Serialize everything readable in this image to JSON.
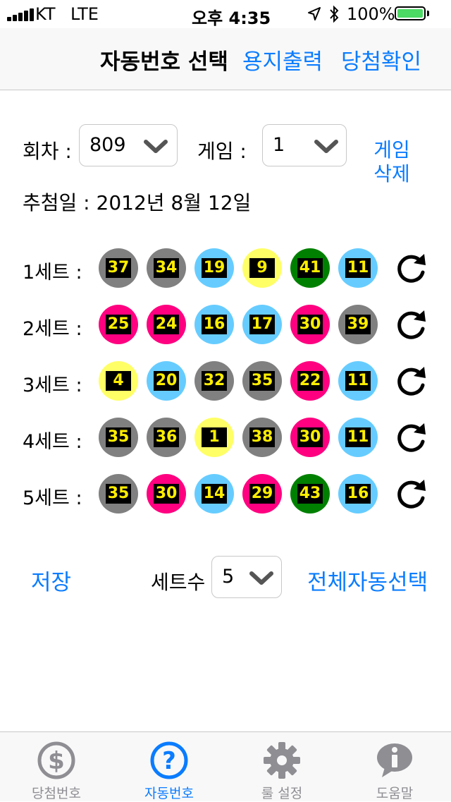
{
  "status": {
    "carrier": "KT",
    "network": "LTE",
    "time": "오후 4:35",
    "battery": "100%"
  },
  "navbar": {
    "title": "자동번호 선택",
    "print_label": "용지출력",
    "check_label": "당첨확인"
  },
  "controls": {
    "round_label": "회차 :",
    "round_value": "809",
    "game_label": "게임 :",
    "game_value": "1",
    "delete_line1": "게임",
    "delete_line2": "삭제",
    "draw_date": "추첨일 : 2012년 8월 12일"
  },
  "sets": [
    {
      "label": "1세트 :",
      "balls": [
        {
          "n": "37",
          "c": "#808080"
        },
        {
          "n": "34",
          "c": "#808080"
        },
        {
          "n": "19",
          "c": "#66ccff"
        },
        {
          "n": "9",
          "c": "#ffff66"
        },
        {
          "n": "41",
          "c": "#008000"
        },
        {
          "n": "11",
          "c": "#66ccff"
        }
      ]
    },
    {
      "label": "2세트 :",
      "balls": [
        {
          "n": "25",
          "c": "#ff0080"
        },
        {
          "n": "24",
          "c": "#ff0080"
        },
        {
          "n": "16",
          "c": "#66ccff"
        },
        {
          "n": "17",
          "c": "#66ccff"
        },
        {
          "n": "30",
          "c": "#ff0080"
        },
        {
          "n": "39",
          "c": "#808080"
        }
      ]
    },
    {
      "label": "3세트 :",
      "balls": [
        {
          "n": "4",
          "c": "#ffff66"
        },
        {
          "n": "20",
          "c": "#66ccff"
        },
        {
          "n": "32",
          "c": "#808080"
        },
        {
          "n": "35",
          "c": "#808080"
        },
        {
          "n": "22",
          "c": "#ff0080"
        },
        {
          "n": "11",
          "c": "#66ccff"
        }
      ]
    },
    {
      "label": "4세트 :",
      "balls": [
        {
          "n": "35",
          "c": "#808080"
        },
        {
          "n": "36",
          "c": "#808080"
        },
        {
          "n": "1",
          "c": "#ffff66"
        },
        {
          "n": "38",
          "c": "#808080"
        },
        {
          "n": "30",
          "c": "#ff0080"
        },
        {
          "n": "11",
          "c": "#66ccff"
        }
      ]
    },
    {
      "label": "5세트 :",
      "balls": [
        {
          "n": "35",
          "c": "#808080"
        },
        {
          "n": "30",
          "c": "#ff0080"
        },
        {
          "n": "14",
          "c": "#66ccff"
        },
        {
          "n": "29",
          "c": "#ff0080"
        },
        {
          "n": "43",
          "c": "#008000"
        },
        {
          "n": "16",
          "c": "#66ccff"
        }
      ]
    }
  ],
  "footer": {
    "save_label": "저장",
    "set_count_label": "세트수",
    "set_count_value": "5",
    "auto_all_label": "전체자동선택"
  },
  "tabs": [
    {
      "label": "당첨번호",
      "icon": "dollar-icon"
    },
    {
      "label": "자동번호",
      "icon": "question-icon",
      "active": true
    },
    {
      "label": "룰 설정",
      "icon": "gear-icon"
    },
    {
      "label": "도움말",
      "icon": "info-icon"
    }
  ],
  "colors": {
    "accent": "#0a7cff",
    "gray_ball": "#808080",
    "blue_ball": "#66ccff",
    "yellow_ball": "#ffff66",
    "green_ball": "#008000",
    "pink_ball": "#ff0080"
  }
}
